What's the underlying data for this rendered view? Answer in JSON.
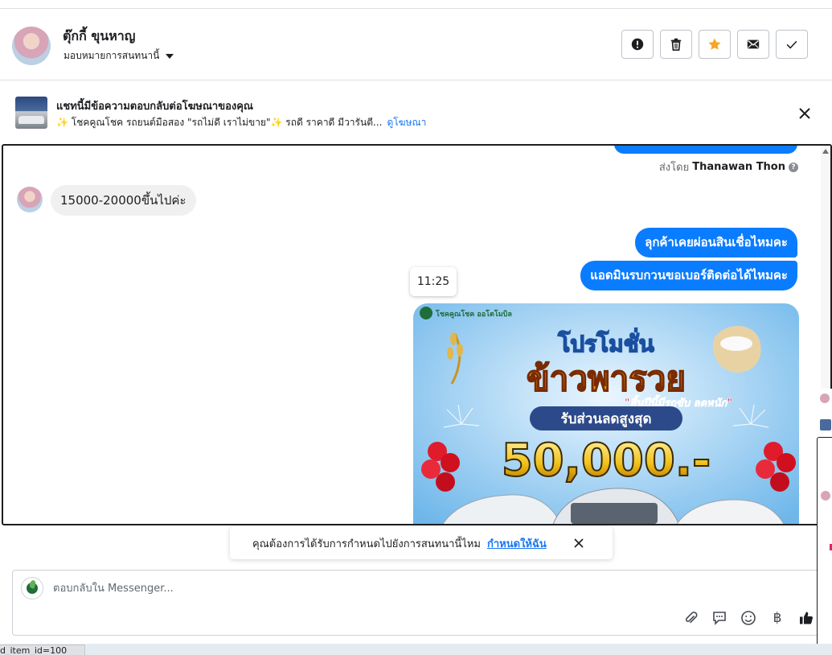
{
  "header": {
    "contact_name": "ตุ๊กกี้ ขุนหาญ",
    "assign_label": "มอบหมายการสนทนานี้"
  },
  "actions": [
    {
      "name": "report",
      "icon": "exclamation-circle-icon"
    },
    {
      "name": "delete",
      "icon": "trash-icon"
    },
    {
      "name": "star",
      "icon": "star-icon",
      "color": "#f5a623"
    },
    {
      "name": "mark-unread",
      "icon": "envelope-icon"
    },
    {
      "name": "mark-done",
      "icon": "checkmark-icon"
    }
  ],
  "ad_banner": {
    "title": "แชทนี้มีข้อความตอบกลับต่อโฆษณาของคุณ",
    "subtitle": "✨ โชคคูณโชค รถยนต์มือสอง \"รถไม่ดี เราไม่ขาย\"✨ รถดี ราคาดี มีวารันตี...",
    "link": "ดูโฆษณา"
  },
  "chat": {
    "sent_by_prefix": "ส่งโดย",
    "sent_by_name": "Thanawan Thon",
    "messages": [
      {
        "direction": "in",
        "text": "15000-20000ขึ้นไปค่ะ"
      },
      {
        "direction": "out",
        "text": "ลุกค้าเคยผ่อนสินเชื่อไหมคะ"
      },
      {
        "direction": "out",
        "text": "แอดมินรบกวนขอเบอร์ติดต่อได้ไหมคะ"
      }
    ],
    "time_tooltip": "11:25",
    "promo": {
      "brand": "โชคคูณโชค ออโตโมบิล",
      "headline_top": "โปรโมชั่น",
      "headline_main": "ข้าวพารวย",
      "tagline": "\"สิ้นปีนี้มีรถขับ ลดหนัก\"",
      "discount_label": "รับส่วนลดสูงสุด",
      "amount": "50,000.-"
    }
  },
  "assign_prompt": {
    "text": "คุณต้องการได้รับการกำหนดไปยังการสนทนานี้ไหม",
    "link": "กำหนดให้ฉัน"
  },
  "reply": {
    "placeholder": "ตอบกลับใน Messenger..."
  },
  "status_bar": {
    "url": "d_item_id=100"
  },
  "colors": {
    "accent_blue": "#1877f2",
    "bubble_blue": "#0a7cff",
    "star_orange": "#f5a623"
  }
}
